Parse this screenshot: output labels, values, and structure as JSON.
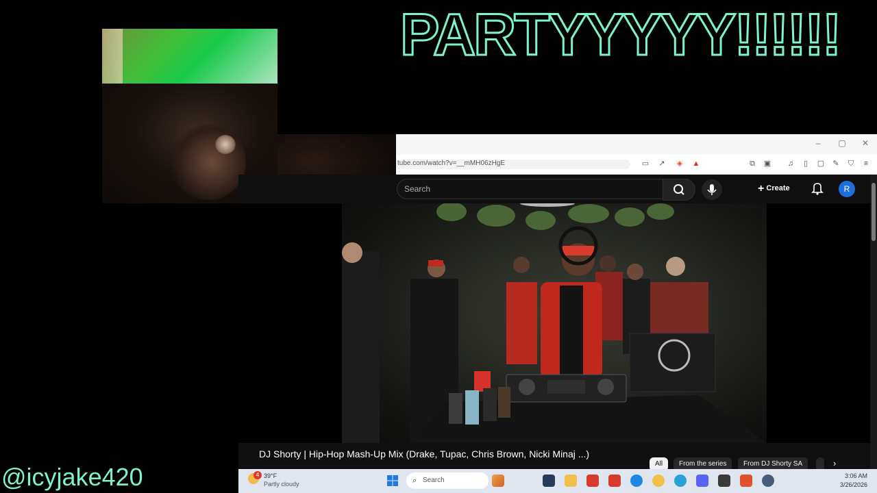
{
  "overlay": {
    "title": "PARTYYYYY!!!!!!",
    "handle": "@icyjake420"
  },
  "browser": {
    "url": "tube.com/watch?v=__mMH06zHgE",
    "min": "–",
    "max": "▢",
    "close": "✕"
  },
  "youtube": {
    "search_placeholder": "Search",
    "create_label": "Create",
    "avatar_letter": "R",
    "video_title": "DJ Shorty | Hip-Hop Mash-Up Mix (Drake, Tupac, Chris Brown, Nicki Minaj ...)",
    "chips": [
      "All",
      "From the series",
      "From DJ Shorty SA"
    ]
  },
  "taskbar": {
    "weather_temp": "39°F",
    "weather_desc": "Partly cloudy",
    "weather_badge": "4",
    "search_placeholder": "Search",
    "time": "3:06 AM",
    "date": "3/26/2026"
  },
  "colors": {
    "accent_teal": "#7ef1cf",
    "yt_bg": "#0f0f0f",
    "avatar": "#1e6fd9"
  }
}
